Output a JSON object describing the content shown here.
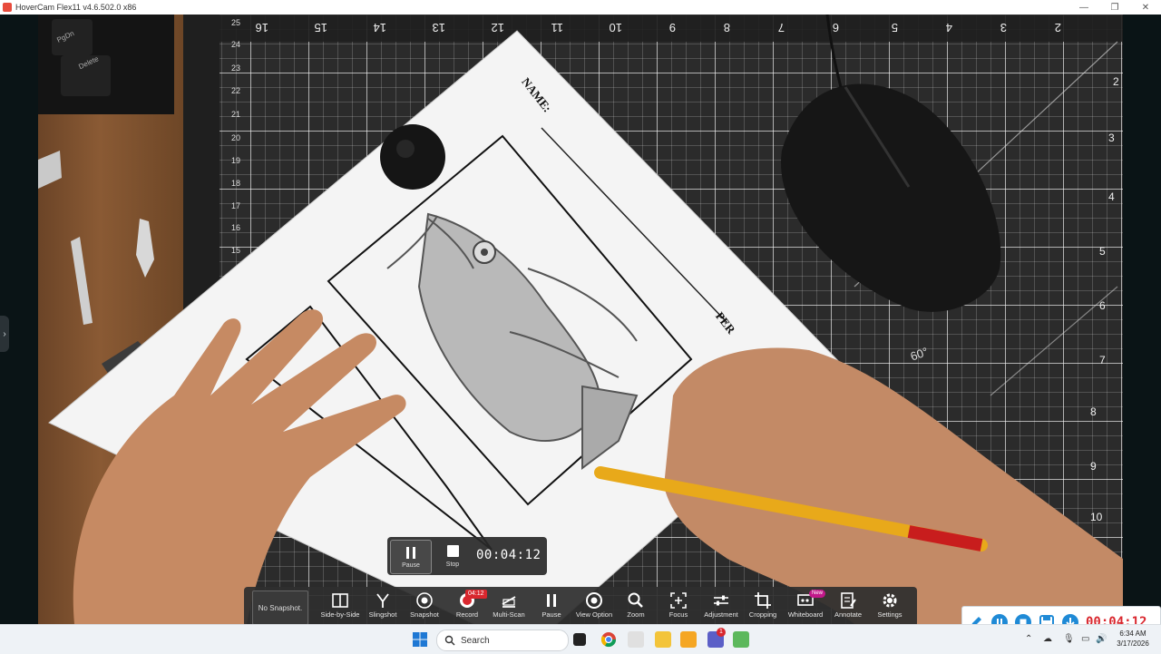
{
  "window": {
    "title": "HoverCam Flex11 v4.6.502.0 x86",
    "controls": [
      "minimize",
      "restore",
      "close"
    ]
  },
  "camera_feed": {
    "paper_labels": [
      "NAME:",
      "PER"
    ],
    "ruler_marks_top": [
      "16",
      "15",
      "14",
      "13",
      "12",
      "11",
      "10",
      "9",
      "8",
      "7",
      "6",
      "5",
      "4",
      "3",
      "2"
    ],
    "ruler_marks_left": [
      "25",
      "24",
      "23",
      "22",
      "21",
      "20",
      "19",
      "18",
      "17",
      "16",
      "15"
    ],
    "ruler_marks_right": [
      "2",
      "3",
      "4",
      "5",
      "6",
      "7",
      "8",
      "9",
      "10"
    ],
    "mat_label": "60°",
    "keyboard_labels": [
      "PgDn",
      "Delete"
    ]
  },
  "recording_popup": {
    "pause_label": "Pause",
    "stop_label": "Stop",
    "timer": "00:04:12"
  },
  "toolbar": {
    "snapshot_status": "No Snapshot.",
    "record_badge": "04:12",
    "whiteboard_badge": "New",
    "items": [
      {
        "label": "Side-by-Side",
        "icon": "side-by-side-icon"
      },
      {
        "label": "Slingshot",
        "icon": "slingshot-icon"
      },
      {
        "label": "Snapshot",
        "icon": "camera-aperture-icon"
      },
      {
        "label": "Record",
        "icon": "record-icon"
      },
      {
        "label": "Multi-Scan",
        "icon": "multi-scan-icon"
      },
      {
        "label": "Pause",
        "icon": "pause-icon"
      },
      {
        "label": "View Option",
        "icon": "eye-icon"
      },
      {
        "label": "Zoom",
        "icon": "magnifier-icon"
      },
      {
        "label": "Focus",
        "icon": "focus-icon"
      },
      {
        "label": "Adjustment",
        "icon": "sliders-icon"
      },
      {
        "label": "Cropping",
        "icon": "crop-icon"
      },
      {
        "label": "Whiteboard",
        "icon": "whiteboard-icon"
      },
      {
        "label": "Annotate",
        "icon": "annotate-icon"
      },
      {
        "label": "Settings",
        "icon": "gear-icon"
      }
    ]
  },
  "mini_recorder": {
    "timer": "00:04:12",
    "buttons": [
      "pencil-icon",
      "pause-icon",
      "stop-icon",
      "save-icon",
      "download-icon"
    ],
    "accent": "#1f8ad6",
    "timer_color": "#d9272e"
  },
  "taskbar": {
    "search_placeholder": "Search",
    "time": "6:34 AM",
    "date": "3/17/2026",
    "notification_count": "1"
  }
}
